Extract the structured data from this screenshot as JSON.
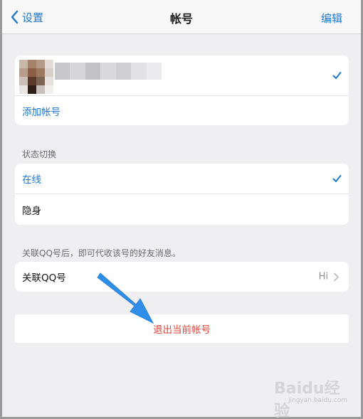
{
  "navbar": {
    "back_label": "设置",
    "title": "帐号",
    "edit_label": "编辑"
  },
  "accounts": {
    "add_account_label": "添加帐号"
  },
  "status": {
    "section_title": "状态切换",
    "online_label": "在线",
    "invisible_label": "隐身"
  },
  "qq": {
    "section_title": "关联QQ号后，即可代收该号的好友消息。",
    "link_label": "关联QQ号",
    "link_value": "Hi"
  },
  "logout": {
    "label": "退出当前帐号"
  },
  "watermark": {
    "brand": "Baidu经验",
    "url": "jingyan.baidu.com"
  },
  "colors": {
    "accent": "#1f77d2",
    "danger": "#e0443a",
    "arrow": "#2f8ee8"
  }
}
